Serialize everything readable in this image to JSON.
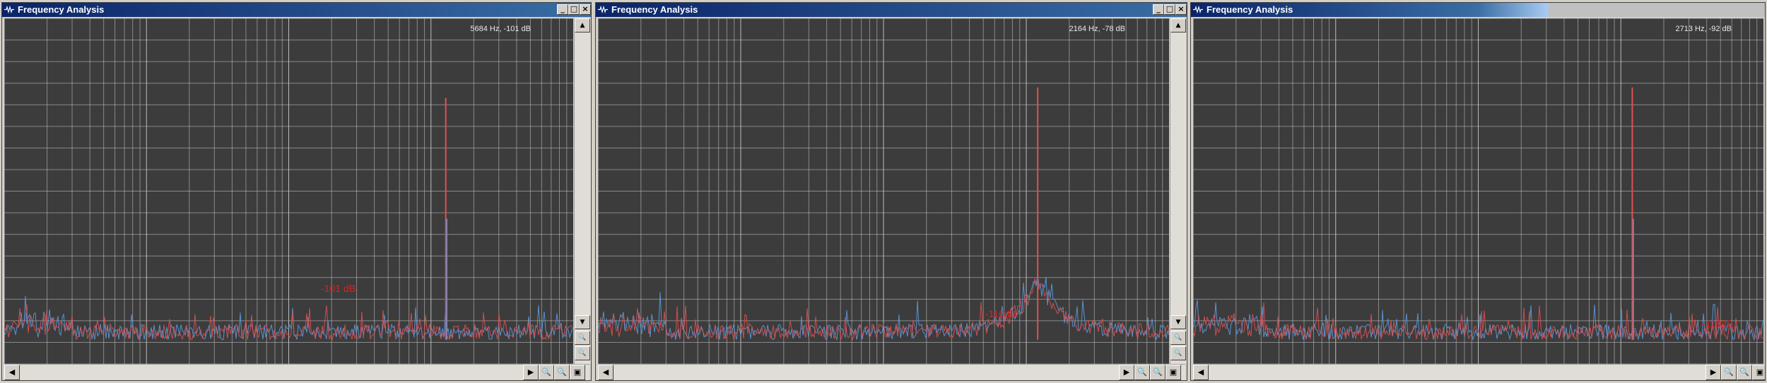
{
  "panels": [
    {
      "title": "Frequency Analysis",
      "readout": "5684 Hz, -101 dB",
      "marker": "-101 dB",
      "spike_at": 0.776,
      "spike_level": 0.77,
      "secondary_spike_level": 0.42,
      "shape": "flat"
    },
    {
      "title": "Frequency Analysis",
      "readout": "2164 Hz, -78 dB",
      "marker": "-110dB",
      "spike_at": 0.77,
      "spike_level": 0.8,
      "secondary_spike_level": 0,
      "shape": "skirt"
    },
    {
      "title": "Frequency Analysis",
      "readout": "2713 Hz, -92 dB",
      "marker": "-110dB",
      "spike_at": 0.77,
      "spike_level": 0.8,
      "secondary_spike_level": 0.42,
      "shape": "flat"
    }
  ],
  "buttons": {
    "minimize": "_",
    "maximize": "□",
    "close": "×",
    "zoom_in": "🔍",
    "zoom_out": "🔍",
    "zoom_fit": "▣"
  },
  "colors": {
    "background": "#3c3c3c",
    "grid": "#c9c9c9",
    "series_left": "#e05050",
    "series_right": "#5a9be0",
    "marker": "#e02020"
  },
  "icons": {
    "window": "waveform-icon",
    "scroll_up": "arrow-up-icon",
    "scroll_down": "arrow-down-icon",
    "scroll_left": "arrow-left-icon",
    "scroll_right": "arrow-right-icon"
  }
}
